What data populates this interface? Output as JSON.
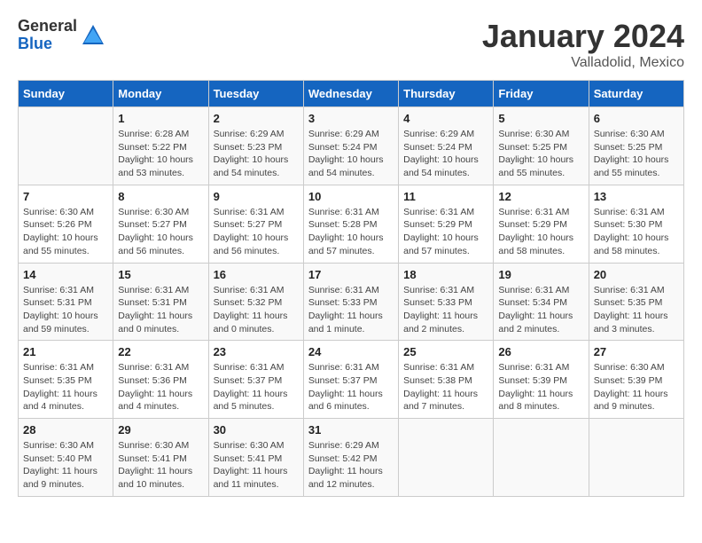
{
  "header": {
    "logo_general": "General",
    "logo_blue": "Blue",
    "month_title": "January 2024",
    "location": "Valladolid, Mexico"
  },
  "days_of_week": [
    "Sunday",
    "Monday",
    "Tuesday",
    "Wednesday",
    "Thursday",
    "Friday",
    "Saturday"
  ],
  "weeks": [
    [
      {
        "day": "",
        "info": ""
      },
      {
        "day": "1",
        "info": "Sunrise: 6:28 AM\nSunset: 5:22 PM\nDaylight: 10 hours\nand 53 minutes."
      },
      {
        "day": "2",
        "info": "Sunrise: 6:29 AM\nSunset: 5:23 PM\nDaylight: 10 hours\nand 54 minutes."
      },
      {
        "day": "3",
        "info": "Sunrise: 6:29 AM\nSunset: 5:24 PM\nDaylight: 10 hours\nand 54 minutes."
      },
      {
        "day": "4",
        "info": "Sunrise: 6:29 AM\nSunset: 5:24 PM\nDaylight: 10 hours\nand 54 minutes."
      },
      {
        "day": "5",
        "info": "Sunrise: 6:30 AM\nSunset: 5:25 PM\nDaylight: 10 hours\nand 55 minutes."
      },
      {
        "day": "6",
        "info": "Sunrise: 6:30 AM\nSunset: 5:25 PM\nDaylight: 10 hours\nand 55 minutes."
      }
    ],
    [
      {
        "day": "7",
        "info": "Sunrise: 6:30 AM\nSunset: 5:26 PM\nDaylight: 10 hours\nand 55 minutes."
      },
      {
        "day": "8",
        "info": "Sunrise: 6:30 AM\nSunset: 5:27 PM\nDaylight: 10 hours\nand 56 minutes."
      },
      {
        "day": "9",
        "info": "Sunrise: 6:31 AM\nSunset: 5:27 PM\nDaylight: 10 hours\nand 56 minutes."
      },
      {
        "day": "10",
        "info": "Sunrise: 6:31 AM\nSunset: 5:28 PM\nDaylight: 10 hours\nand 57 minutes."
      },
      {
        "day": "11",
        "info": "Sunrise: 6:31 AM\nSunset: 5:29 PM\nDaylight: 10 hours\nand 57 minutes."
      },
      {
        "day": "12",
        "info": "Sunrise: 6:31 AM\nSunset: 5:29 PM\nDaylight: 10 hours\nand 58 minutes."
      },
      {
        "day": "13",
        "info": "Sunrise: 6:31 AM\nSunset: 5:30 PM\nDaylight: 10 hours\nand 58 minutes."
      }
    ],
    [
      {
        "day": "14",
        "info": "Sunrise: 6:31 AM\nSunset: 5:31 PM\nDaylight: 10 hours\nand 59 minutes."
      },
      {
        "day": "15",
        "info": "Sunrise: 6:31 AM\nSunset: 5:31 PM\nDaylight: 11 hours\nand 0 minutes."
      },
      {
        "day": "16",
        "info": "Sunrise: 6:31 AM\nSunset: 5:32 PM\nDaylight: 11 hours\nand 0 minutes."
      },
      {
        "day": "17",
        "info": "Sunrise: 6:31 AM\nSunset: 5:33 PM\nDaylight: 11 hours\nand 1 minute."
      },
      {
        "day": "18",
        "info": "Sunrise: 6:31 AM\nSunset: 5:33 PM\nDaylight: 11 hours\nand 2 minutes."
      },
      {
        "day": "19",
        "info": "Sunrise: 6:31 AM\nSunset: 5:34 PM\nDaylight: 11 hours\nand 2 minutes."
      },
      {
        "day": "20",
        "info": "Sunrise: 6:31 AM\nSunset: 5:35 PM\nDaylight: 11 hours\nand 3 minutes."
      }
    ],
    [
      {
        "day": "21",
        "info": "Sunrise: 6:31 AM\nSunset: 5:35 PM\nDaylight: 11 hours\nand 4 minutes."
      },
      {
        "day": "22",
        "info": "Sunrise: 6:31 AM\nSunset: 5:36 PM\nDaylight: 11 hours\nand 4 minutes."
      },
      {
        "day": "23",
        "info": "Sunrise: 6:31 AM\nSunset: 5:37 PM\nDaylight: 11 hours\nand 5 minutes."
      },
      {
        "day": "24",
        "info": "Sunrise: 6:31 AM\nSunset: 5:37 PM\nDaylight: 11 hours\nand 6 minutes."
      },
      {
        "day": "25",
        "info": "Sunrise: 6:31 AM\nSunset: 5:38 PM\nDaylight: 11 hours\nand 7 minutes."
      },
      {
        "day": "26",
        "info": "Sunrise: 6:31 AM\nSunset: 5:39 PM\nDaylight: 11 hours\nand 8 minutes."
      },
      {
        "day": "27",
        "info": "Sunrise: 6:30 AM\nSunset: 5:39 PM\nDaylight: 11 hours\nand 9 minutes."
      }
    ],
    [
      {
        "day": "28",
        "info": "Sunrise: 6:30 AM\nSunset: 5:40 PM\nDaylight: 11 hours\nand 9 minutes."
      },
      {
        "day": "29",
        "info": "Sunrise: 6:30 AM\nSunset: 5:41 PM\nDaylight: 11 hours\nand 10 minutes."
      },
      {
        "day": "30",
        "info": "Sunrise: 6:30 AM\nSunset: 5:41 PM\nDaylight: 11 hours\nand 11 minutes."
      },
      {
        "day": "31",
        "info": "Sunrise: 6:29 AM\nSunset: 5:42 PM\nDaylight: 11 hours\nand 12 minutes."
      },
      {
        "day": "",
        "info": ""
      },
      {
        "day": "",
        "info": ""
      },
      {
        "day": "",
        "info": ""
      }
    ]
  ]
}
